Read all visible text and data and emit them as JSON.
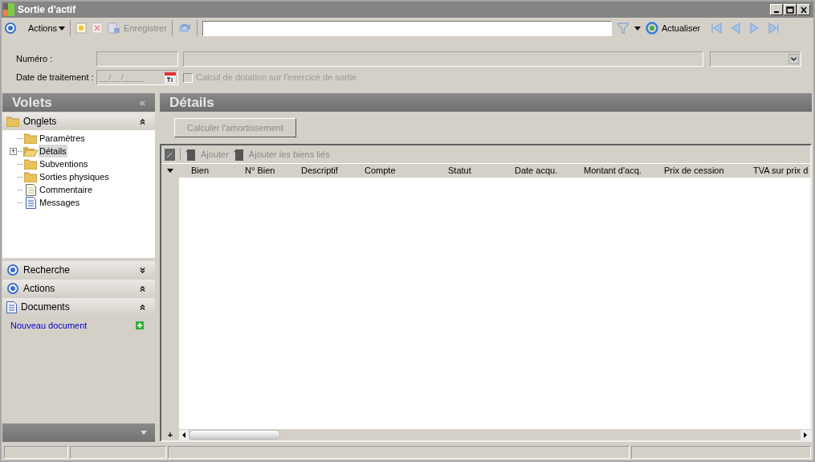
{
  "window": {
    "title": "Sortie d'actif"
  },
  "toolbar": {
    "actions": "Actions",
    "save": {
      "label": "Enregistrer",
      "disabled": true
    },
    "refresh": "Actualiser"
  },
  "form": {
    "number_label": "Numéro :",
    "date_label": "Date de traitement :",
    "date_value": "__/__/____",
    "checkbox": {
      "label": "Calcul de dotation sur l'exercice de sortie",
      "checked": false,
      "disabled": true
    }
  },
  "sidebar": {
    "title": "Volets",
    "collapse": "«",
    "sections": [
      {
        "title": "Onglets",
        "kind": "folder",
        "expanded": true,
        "items": [
          {
            "label": "Paramètres",
            "kind": "folder",
            "selected": false
          },
          {
            "label": "Détails",
            "kind": "folder-open",
            "selected": true,
            "expander": "+"
          },
          {
            "label": "Subventions",
            "kind": "folder",
            "selected": false
          },
          {
            "label": "Sorties physiques",
            "kind": "folder",
            "selected": false
          },
          {
            "label": "Commentaire",
            "kind": "note",
            "selected": false
          },
          {
            "label": "Messages",
            "kind": "document",
            "selected": false
          }
        ]
      },
      {
        "title": "Recherche",
        "kind": "target",
        "expanded": false
      },
      {
        "title": "Actions",
        "kind": "target",
        "expanded": true
      },
      {
        "title": "Documents",
        "kind": "document",
        "expanded": true,
        "link": "Nouveau document"
      }
    ]
  },
  "main": {
    "title": "Détails",
    "button": {
      "label": "Calculer l'amortissement",
      "disabled": true
    },
    "grid": {
      "toolbar": [
        {
          "label": "Ajouter",
          "disabled": true
        },
        {
          "label": "Ajouter les biens liés",
          "disabled": true
        }
      ],
      "columns": [
        "Bien",
        "N° Bien",
        "Descriptif",
        "Compte",
        "Statut",
        "Date acqu.",
        "Montant d'acq.",
        "Prix de cession",
        "TVA sur prix d"
      ],
      "add_row": "+",
      "scroll": {
        "level": 0.15
      }
    }
  }
}
